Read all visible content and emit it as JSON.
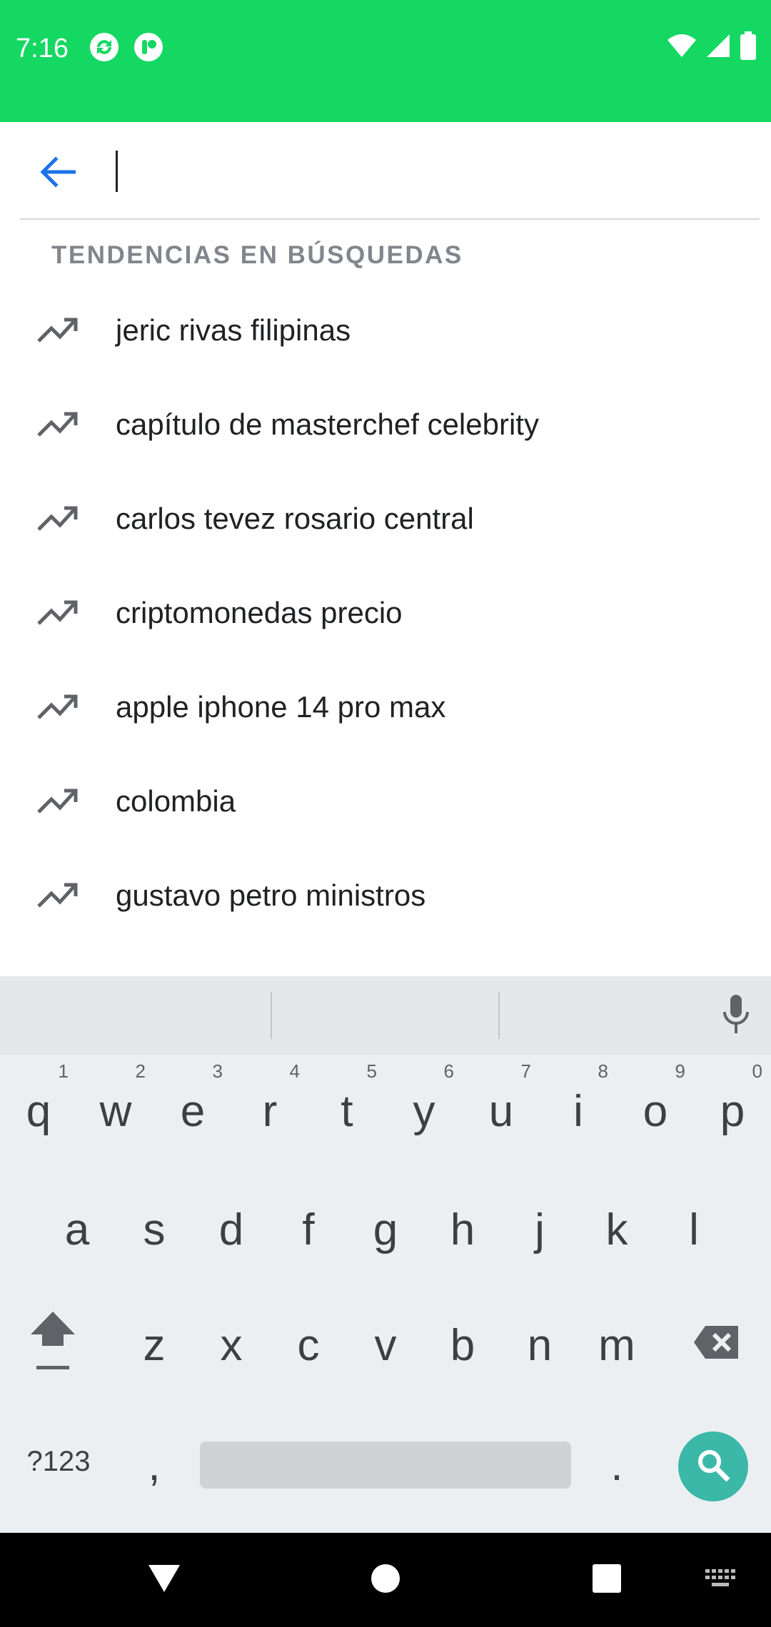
{
  "status_bar": {
    "time": "7:16",
    "background_color": "#15d862",
    "left_icons": [
      "sync-icon",
      "app-notification-icon"
    ],
    "right_icons": [
      "wifi-icon",
      "cell-signal-icon",
      "battery-icon"
    ]
  },
  "search": {
    "value": "",
    "placeholder": ""
  },
  "trending": {
    "heading": "TENDENCIAS EN BÚSQUEDAS",
    "items": [
      {
        "label": "jeric rivas filipinas",
        "icon": "trending-up-icon"
      },
      {
        "label": "capítulo de masterchef celebrity",
        "icon": "trending-up-icon"
      },
      {
        "label": "carlos tevez rosario central",
        "icon": "trending-up-icon"
      },
      {
        "label": "criptomonedas precio",
        "icon": "trending-up-icon"
      },
      {
        "label": "apple iphone 14 pro max",
        "icon": "trending-up-icon"
      },
      {
        "label": "colombia",
        "icon": "trending-up-icon"
      },
      {
        "label": "gustavo petro ministros",
        "icon": "trending-up-icon"
      }
    ]
  },
  "keyboard": {
    "row1": [
      {
        "key": "q",
        "hint": "1"
      },
      {
        "key": "w",
        "hint": "2"
      },
      {
        "key": "e",
        "hint": "3"
      },
      {
        "key": "r",
        "hint": "4"
      },
      {
        "key": "t",
        "hint": "5"
      },
      {
        "key": "y",
        "hint": "6"
      },
      {
        "key": "u",
        "hint": "7"
      },
      {
        "key": "i",
        "hint": "8"
      },
      {
        "key": "o",
        "hint": "9"
      },
      {
        "key": "p",
        "hint": "0"
      }
    ],
    "row2": [
      "a",
      "s",
      "d",
      "f",
      "g",
      "h",
      "j",
      "k",
      "l"
    ],
    "row3": [
      "z",
      "x",
      "c",
      "v",
      "b",
      "n",
      "m"
    ],
    "symbols_label": "?123",
    "comma": ",",
    "period": ".",
    "accent_color": "#3bb8a8"
  }
}
